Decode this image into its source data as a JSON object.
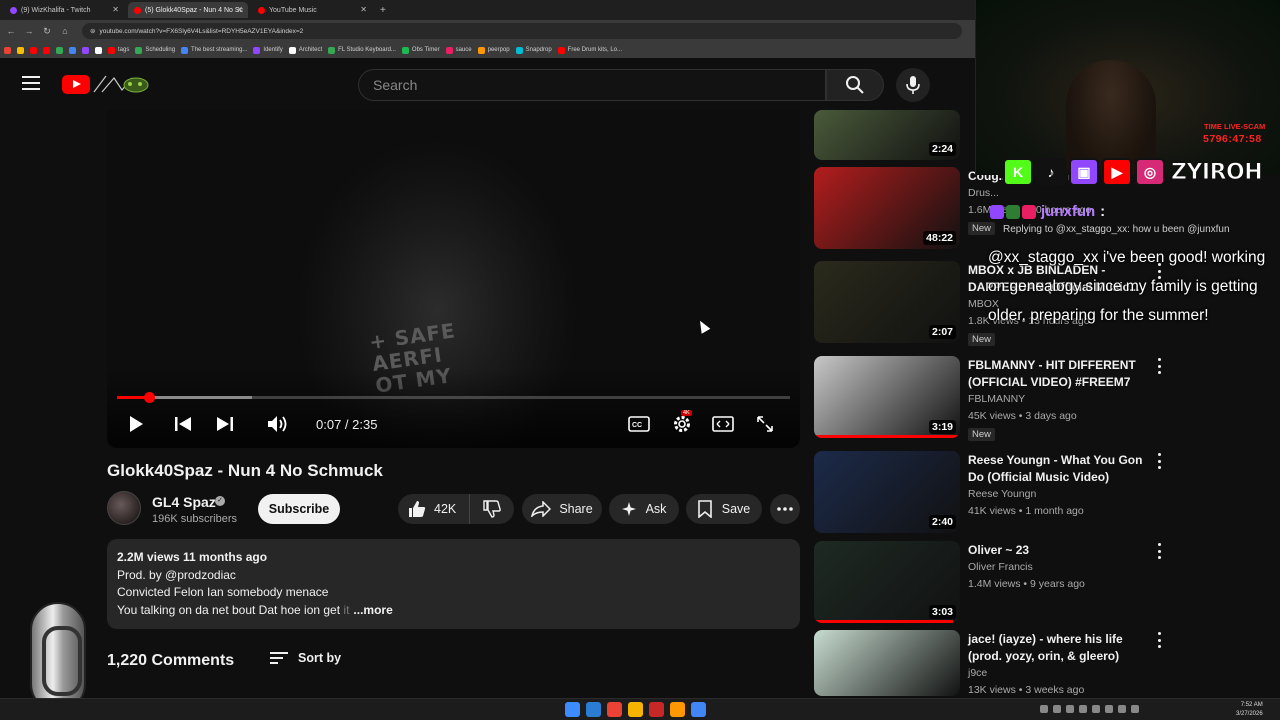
{
  "browser": {
    "tabs": [
      {
        "label": "(9) WizKhalifa - Twitch",
        "favicon_color": "#9146ff",
        "active": false
      },
      {
        "label": "(5) Glokk40Spaz - Nun 4 No Sc",
        "favicon_color": "#ff0000",
        "active": true
      },
      {
        "label": "YouTube Music",
        "favicon_color": "#ff0000",
        "active": false
      }
    ],
    "new_tab_icon": "plus-icon",
    "url": "youtube.com/watch?v=FX6Sly6V4Ls&list=RDYH5eAZV1EYA&index=2",
    "bookmarks": [
      "tags",
      "Scheduling",
      "The best streaming...",
      "Identify",
      "Architect",
      "FL Studio Keyboard...",
      "Obs Timer",
      "sauce",
      "peerpop",
      "Snapdrop",
      "Free Drum kits, Lo..."
    ],
    "bookmark_colors": [
      "#ea4335",
      "#fbbc04",
      "#ff0000",
      "#ff0000",
      "#34a853",
      "#4285f4",
      "#9146ff",
      "#ffffff",
      "#34a853",
      "#1db954",
      "#e91e63",
      "#ff9800",
      "#00bcd4",
      "#ff0000",
      "#ff5722",
      "#4caf50"
    ]
  },
  "header": {
    "search_placeholder": "Search",
    "menu_icon": "hamburger-icon",
    "search_icon": "search-icon",
    "mic_icon": "microphone-icon"
  },
  "player": {
    "current_time": "0:07",
    "duration": "2:35",
    "time_display": "0:07 / 2:35",
    "progress_played": 0.048,
    "progress_buffered": 0.2,
    "settings_badge": "4K",
    "shirt_text": "+ SAFE\nAERFI\nOT MY"
  },
  "video": {
    "title": "Glokk40Spaz - Nun 4 No Schmuck",
    "channel": "GL4 Spaz",
    "subscribers": "196K subscribers",
    "subscribe_label": "Subscribe",
    "likes": "42K",
    "share_label": "Share",
    "ask_label": "Ask",
    "save_label": "Save"
  },
  "description": {
    "meta": "2.2M views  11 months ago",
    "lines": [
      "Prod. by @prodzodiac",
      "Convicted Felon Ian somebody menace"
    ],
    "truncated_line": "You talking on da net bout Dat hoe ion get",
    "truncated_fade": " it",
    "more_label": "...more"
  },
  "comments": {
    "count_label": "1,220 Comments",
    "sort_label": "Sort by"
  },
  "recommendations": [
    {
      "title": "",
      "channel": "",
      "meta": "",
      "duration": "2:24",
      "new": false,
      "thumb_color": "#4a5a3a",
      "watched": 0
    },
    {
      "title": "Coug... The Final Rose",
      "channel": "Drus...",
      "meta": "1.6M views • 10 hours ago",
      "duration": "48:22",
      "new": true,
      "thumb_color": "#b31d1d",
      "watched": 0
    },
    {
      "title": "MBOX x JB BINLADEN - DAPPERDAN (Official Music...",
      "channel": "MBOX",
      "meta": "1.8K views • 13 hours ago",
      "duration": "2:07",
      "new": true,
      "thumb_color": "#2a2a1c",
      "watched": 0
    },
    {
      "title": "FBLMANNY - HIT DIFFERENT (OFFICIAL VIDEO) #FREEM7",
      "channel": "FBLMANNY",
      "meta": "45K views • 3 days ago",
      "duration": "3:19",
      "new": true,
      "thumb_color": "#c8c8c8",
      "watched": 1
    },
    {
      "title": "Reese Youngn - What You Gon Do (Official Music Video)",
      "channel": "Reese Youngn",
      "meta": "41K views • 1 month ago",
      "duration": "2:40",
      "new": false,
      "thumb_color": "#1c2a4a",
      "watched": 0
    },
    {
      "title": "Oliver ~ 23",
      "channel": "Oliver Francis",
      "meta": "1.4M views • 9 years ago",
      "duration": "3:03",
      "new": false,
      "thumb_color": "#1e2a24",
      "watched": 0.95
    },
    {
      "title": "jace! (iayze) - where his life (prod. yozy, orin, & gleero)",
      "channel": "j9ce",
      "meta": "13K views • 3 weeks ago",
      "duration": "",
      "new": false,
      "thumb_color": "#c8dcd0",
      "watched": 0
    }
  ],
  "stream_overlay": {
    "timer_label": "TIME LIVE-SCAM",
    "timer_value": "5796:47:58",
    "social_icons": [
      {
        "name": "kick-icon",
        "glyph": "K",
        "color": "#53fc18"
      },
      {
        "name": "tiktok-icon",
        "glyph": "♪",
        "color": "#111111"
      },
      {
        "name": "twitch-icon",
        "glyph": "▣",
        "color": "#9146ff"
      },
      {
        "name": "youtube-icon",
        "glyph": "▶",
        "color": "#ff0000"
      },
      {
        "name": "instagram-icon",
        "glyph": "◎",
        "color": "#d62976"
      }
    ],
    "handle": "ZYIROH",
    "chat_username": "junxfun",
    "chat_reply": "Replying to @xx_staggo_xx: how u been @junxfun",
    "chat_message": "@xx_staggo_xx i've been good! working on genealogy since my family is getting older. preparing for the summer!"
  },
  "taskbar": {
    "icons": [
      "#3c8cff",
      "#2b7cd3",
      "#ea4335",
      "#f4b400",
      "#c62828",
      "#ff9800",
      "#4285f4"
    ],
    "time": "7:52 AM",
    "date": "3/27/2026"
  }
}
